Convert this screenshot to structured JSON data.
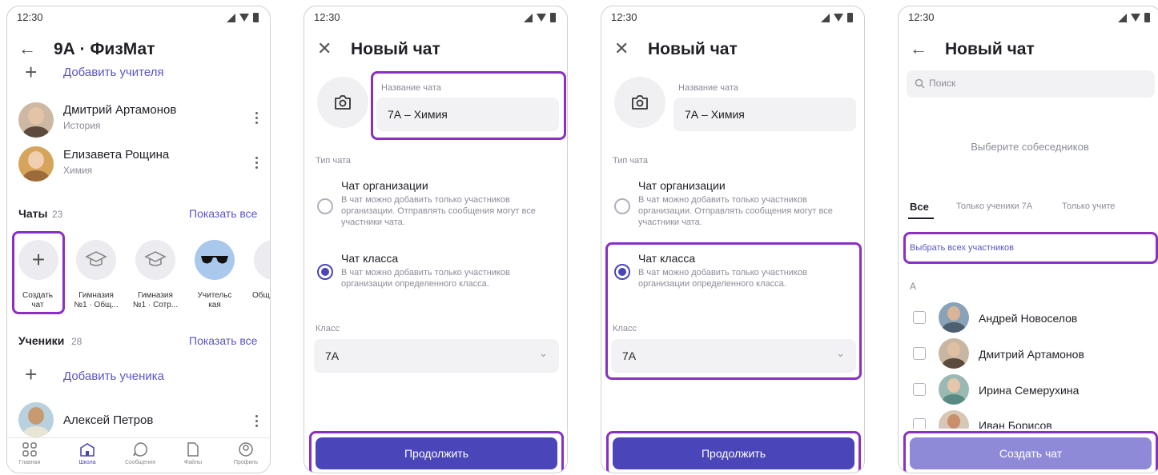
{
  "status": {
    "time": "12:30"
  },
  "screen1": {
    "title": "9А · ФизМат",
    "add_teacher": "Добавить учителя",
    "teachers": [
      {
        "name": "Дмитрий Артамонов",
        "subject": "История"
      },
      {
        "name": "Елизавета Рощина",
        "subject": "Химия"
      }
    ],
    "chats_label": "Чаты",
    "chats_count": "23",
    "show_all_chats": "Показать все",
    "create_chat_l1": "Создать",
    "create_chat_l2": "чат",
    "chats": [
      {
        "l1": "Гимназия",
        "l2": "№1 · Общ..."
      },
      {
        "l1": "Гимназия",
        "l2": "№1 · Сотр..."
      },
      {
        "l1": "Учительс",
        "l2": "кая"
      },
      {
        "l1": "Общ",
        "l2": ""
      }
    ],
    "students_label": "Ученики",
    "students_count": "28",
    "show_all_students": "Показать все",
    "add_student": "Добавить ученика",
    "student": {
      "name": "Алексей Петров"
    },
    "tabs": [
      "Главная",
      "Школа",
      "Сообщения",
      "Файлы",
      "Профиль"
    ]
  },
  "screen2": {
    "title": "Новый чат",
    "name_label": "Название чата",
    "name_value": "7А – Химия",
    "type_label": "Тип чата",
    "org_title": "Чат организации",
    "org_desc": "В чат можно добавить только участников организации. Отправлять сообщения могут все участники чата.",
    "class_title": "Чат класса",
    "class_desc": "В чат можно добавить только участников организации определенного класса.",
    "class_label": "Класс",
    "class_value": "7А",
    "continue": "Продолжить"
  },
  "screen4": {
    "title": "Новый чат",
    "search_placeholder": "Поиск",
    "hint": "Выберите собеседников",
    "tabs": [
      "Все",
      "Только ученики 7А",
      "Только учите"
    ],
    "select_all": "Выбрать всех участников",
    "letter": "А",
    "people": [
      "Андрей Новоселов",
      "Дмитрий Артамонов",
      "Ирина Семерухина",
      "Иван Борисов"
    ],
    "create": "Создать чат"
  },
  "colors": {
    "accent": "#4a45b8",
    "accent_light": "#8f8ad8",
    "highlight": "#8a2fc4"
  }
}
